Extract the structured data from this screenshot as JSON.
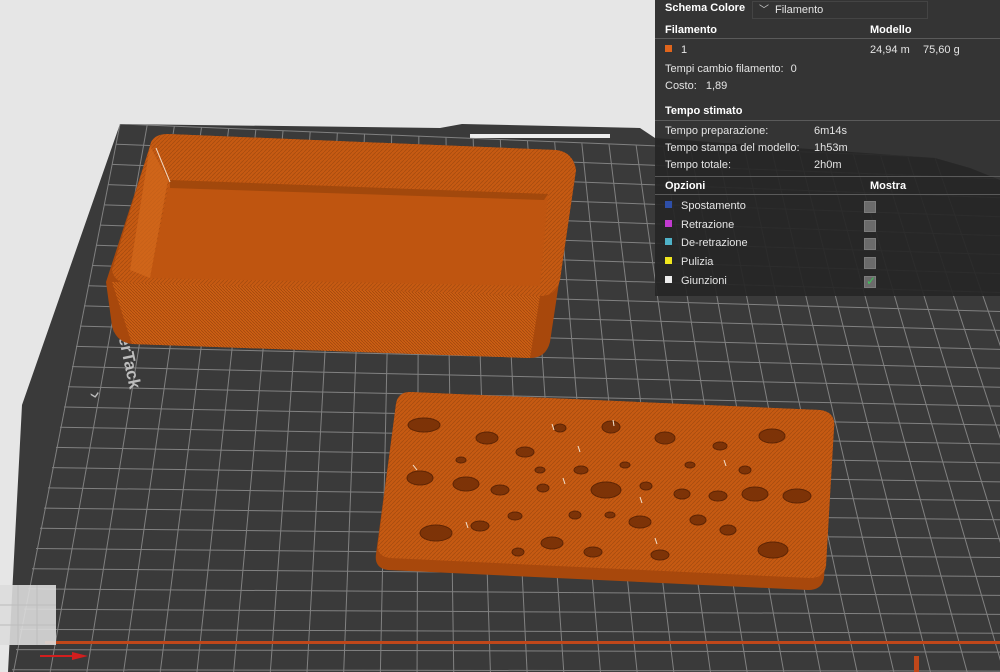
{
  "legend": {
    "scheme_label": "Schema Colore",
    "scheme_value": "Filamento",
    "filament_header": "Filamento",
    "model_header": "Modello",
    "filament_index": "1",
    "filament_color": "#e0651c",
    "filament_length": "24,94 m",
    "filament_weight": "75,60 g",
    "changes_label": "Tempi cambio filamento:",
    "changes_value": "0",
    "cost_label": "Costo:",
    "cost_value": "1,89",
    "time_header": "Tempo stimato",
    "prep_label": "Tempo preparazione:",
    "prep_value": "6m14s",
    "model_time_label": "Tempo stampa del modello:",
    "model_time_value": "1h53m",
    "total_label": "Tempo totale:",
    "total_value": "2h0m",
    "options_header": "Opzioni",
    "show_header": "Mostra",
    "options": [
      {
        "label": "Spostamento",
        "color": "#2e4fa8",
        "checked": false
      },
      {
        "label": "Retrazione",
        "color": "#c23ad0",
        "checked": false
      },
      {
        "label": "De-retrazione",
        "color": "#4fb2c8",
        "checked": false
      },
      {
        "label": "Pulizia",
        "color": "#f0e61e",
        "checked": false
      },
      {
        "label": "Giunzioni",
        "color": "#ececec",
        "checked": true
      }
    ]
  },
  "bed": {
    "plate_text": "SuperTack",
    "plate_color": "#3a3a3a",
    "grid_color": "#8e8e8e",
    "model_color": "#c65a12"
  }
}
